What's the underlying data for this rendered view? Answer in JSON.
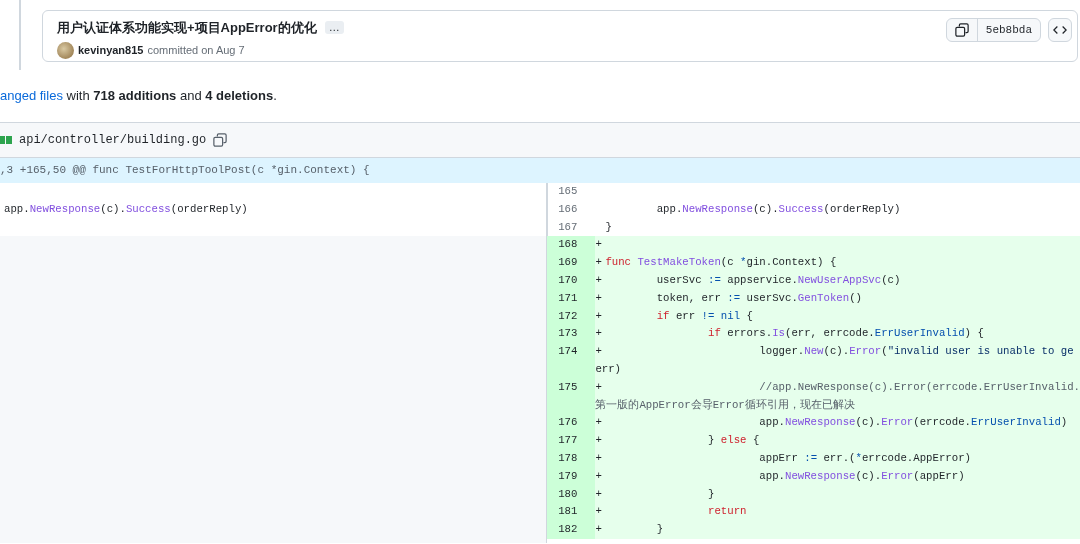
{
  "commit": {
    "title": "用户认证体系功能实现+项目AppError的优化",
    "more": "…",
    "author": "kevinyan815",
    "meta": "committed on Aug 7",
    "sha": "5eb8bda"
  },
  "summary": {
    "link": "anged files",
    "text": " with **718 additions** and **4 deletions**."
  },
  "file": {
    "path": "api/controller/building.go"
  },
  "hunk": ",3 +165,50 @@ func TestForHttpToolPost(c *gin.Context) {",
  "left_rows": [
    {
      "lines": []
    },
    {
      "lines": [
        [
          {
            "kind": "plain",
            "text": "app."
          },
          {
            "kind": "function",
            "text": "NewResponse"
          },
          {
            "kind": "plain",
            "text": "(c)."
          },
          {
            "kind": "function",
            "text": "Success"
          },
          {
            "kind": "plain",
            "text": "(orderReply)"
          }
        ]
      ]
    },
    {
      "lines": []
    }
  ],
  "right_rows": [
    {
      "number": "165",
      "kind": "context",
      "lines": []
    },
    {
      "number": "166",
      "kind": "context",
      "lines": [
        [
          {
            "kind": "plain",
            "text": "\tapp."
          },
          {
            "kind": "function",
            "text": "NewResponse"
          },
          {
            "kind": "plain",
            "text": "(c)."
          },
          {
            "kind": "function",
            "text": "Success"
          },
          {
            "kind": "plain",
            "text": "(orderReply)"
          }
        ]
      ]
    },
    {
      "number": "167",
      "kind": "context",
      "lines": [
        [
          {
            "kind": "plain",
            "text": "}"
          }
        ]
      ]
    },
    {
      "number": "168",
      "kind": "add",
      "marker": "+",
      "lines": []
    },
    {
      "number": "169",
      "kind": "add",
      "marker": "+",
      "lines": [
        [
          {
            "kind": "keyword",
            "text": "func"
          },
          {
            "kind": "function",
            "text": " TestMakeToken"
          },
          {
            "kind": "plain",
            "text": "(c "
          },
          {
            "kind": "constant",
            "text": "*"
          },
          {
            "kind": "plain",
            "text": "gin.Context) {"
          }
        ]
      ]
    },
    {
      "number": "170",
      "kind": "add",
      "marker": "+",
      "lines": [
        [
          {
            "kind": "plain",
            "text": "\tuserSvc "
          },
          {
            "kind": "constant",
            "text": ":="
          },
          {
            "kind": "plain",
            "text": " appservice."
          },
          {
            "kind": "function",
            "text": "NewUserAppSvc"
          },
          {
            "kind": "plain",
            "text": "(c)"
          }
        ]
      ]
    },
    {
      "number": "171",
      "kind": "add",
      "marker": "+",
      "lines": [
        [
          {
            "kind": "plain",
            "text": "\ttoken, err "
          },
          {
            "kind": "constant",
            "text": ":="
          },
          {
            "kind": "plain",
            "text": " userSvc."
          },
          {
            "kind": "function",
            "text": "GenToken"
          },
          {
            "kind": "plain",
            "text": "()"
          }
        ]
      ]
    },
    {
      "number": "172",
      "kind": "add",
      "marker": "+",
      "lines": [
        [
          {
            "kind": "keyword",
            "text": "\tif"
          },
          {
            "kind": "plain",
            "text": " err "
          },
          {
            "kind": "constant",
            "text": "!="
          },
          {
            "kind": "constant",
            "text": " nil"
          },
          {
            "kind": "plain",
            "text": " {"
          }
        ]
      ]
    },
    {
      "number": "173",
      "kind": "add",
      "marker": "+",
      "lines": [
        [
          {
            "kind": "keyword",
            "text": "\t\tif"
          },
          {
            "kind": "plain",
            "text": " errors."
          },
          {
            "kind": "function",
            "text": "Is"
          },
          {
            "kind": "plain",
            "text": "(err, errcode."
          },
          {
            "kind": "constant",
            "text": "ErrUserInvalid"
          },
          {
            "kind": "plain",
            "text": ") {"
          }
        ]
      ]
    },
    {
      "number": "174",
      "kind": "add",
      "marker": "+",
      "lines": [
        [
          {
            "kind": "plain",
            "text": "\t\t\tlogger."
          },
          {
            "kind": "function",
            "text": "New"
          },
          {
            "kind": "plain",
            "text": "(c)."
          },
          {
            "kind": "function",
            "text": "Error"
          },
          {
            "kind": "plain",
            "text": "("
          },
          {
            "kind": "string",
            "text": "\"invalid user is unable to ge"
          }
        ],
        [
          {
            "kind": "plain",
            "text": "err)"
          }
        ]
      ]
    },
    {
      "number": "175",
      "kind": "add",
      "marker": "+",
      "lines": [
        [
          {
            "kind": "comment",
            "text": "\t\t\t//app.NewResponse(c).Error(errcode.ErrUserInvalid."
          }
        ],
        [
          {
            "kind": "comment",
            "text": "第一版的AppError会导Error循环引用，现在已解决"
          }
        ]
      ]
    },
    {
      "number": "176",
      "kind": "add",
      "marker": "+",
      "lines": [
        [
          {
            "kind": "plain",
            "text": "\t\t\tapp."
          },
          {
            "kind": "function",
            "text": "NewResponse"
          },
          {
            "kind": "plain",
            "text": "(c)."
          },
          {
            "kind": "function",
            "text": "Error"
          },
          {
            "kind": "plain",
            "text": "(errcode."
          },
          {
            "kind": "constant",
            "text": "ErrUserInvalid"
          },
          {
            "kind": "plain",
            "text": ")"
          }
        ]
      ]
    },
    {
      "number": "177",
      "kind": "add",
      "marker": "+",
      "lines": [
        [
          {
            "kind": "plain",
            "text": "\t\t} "
          },
          {
            "kind": "keyword",
            "text": "else"
          },
          {
            "kind": "plain",
            "text": " {"
          }
        ]
      ]
    },
    {
      "number": "178",
      "kind": "add",
      "marker": "+",
      "lines": [
        [
          {
            "kind": "plain",
            "text": "\t\t\tappErr "
          },
          {
            "kind": "constant",
            "text": ":="
          },
          {
            "kind": "plain",
            "text": " err.("
          },
          {
            "kind": "constant",
            "text": "*"
          },
          {
            "kind": "plain",
            "text": "errcode.AppError)"
          }
        ]
      ]
    },
    {
      "number": "179",
      "kind": "add",
      "marker": "+",
      "lines": [
        [
          {
            "kind": "plain",
            "text": "\t\t\tapp."
          },
          {
            "kind": "function",
            "text": "NewResponse"
          },
          {
            "kind": "plain",
            "text": "(c)."
          },
          {
            "kind": "function",
            "text": "Error"
          },
          {
            "kind": "plain",
            "text": "(appErr)"
          }
        ]
      ]
    },
    {
      "number": "180",
      "kind": "add",
      "marker": "+",
      "lines": [
        [
          {
            "kind": "plain",
            "text": "\t\t}"
          }
        ]
      ]
    },
    {
      "number": "181",
      "kind": "add",
      "marker": "+",
      "lines": [
        [
          {
            "kind": "keyword",
            "text": "\t\treturn"
          }
        ]
      ]
    },
    {
      "number": "182",
      "kind": "add",
      "marker": "+",
      "lines": [
        [
          {
            "kind": "plain",
            "text": "\t}"
          }
        ]
      ]
    }
  ]
}
